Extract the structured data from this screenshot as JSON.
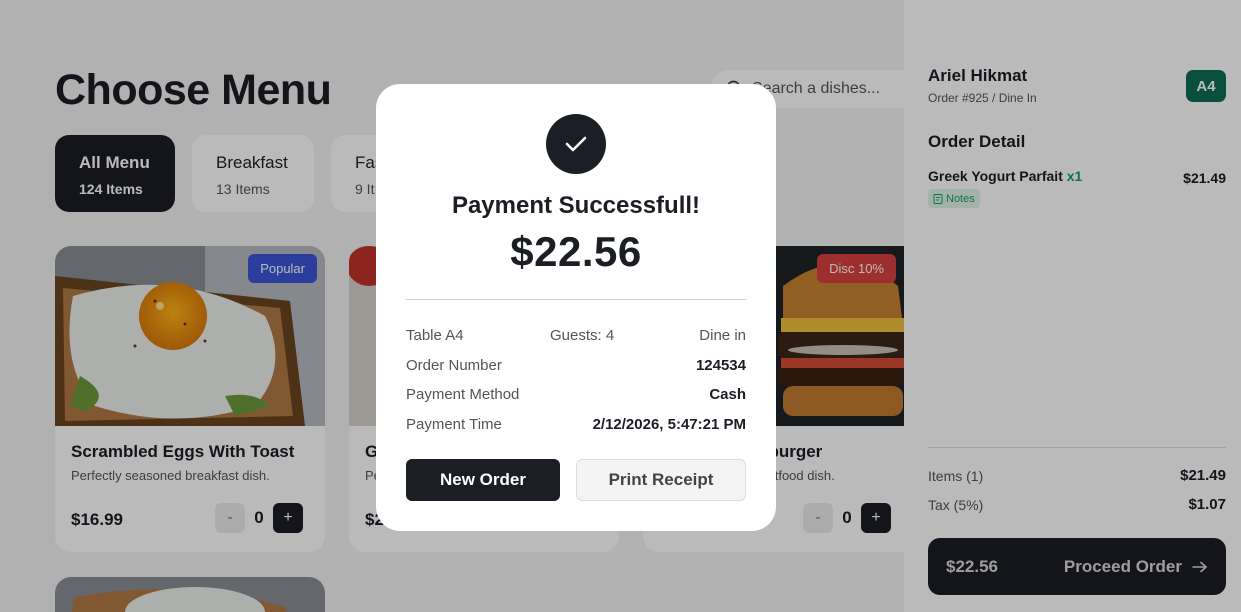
{
  "menu": {
    "title": "Choose Menu",
    "search_placeholder": "Search a dishes...",
    "categories": [
      {
        "name": "All Menu",
        "count": "124 Items",
        "active": true
      },
      {
        "name": "Breakfast",
        "count": "13 Items"
      },
      {
        "name": "Fas",
        "count": "9 It"
      }
    ],
    "cards": [
      {
        "name": "Scrambled Eggs With Toast",
        "description": "Perfectly seasoned breakfast dish.",
        "price": "$16.99",
        "badge": "Popular",
        "quantity": "0"
      },
      {
        "name": "G",
        "description": "Pe",
        "price": "$2"
      },
      {
        "name": "eburger",
        "description": "astfood dish.",
        "badge": "Disc 10%",
        "quantity": "0"
      }
    ],
    "stepper": {
      "minus": "-",
      "plus": "+"
    }
  },
  "order": {
    "customer": "Ariel Hikmat",
    "meta": "Order #925 / Dine In",
    "table_badge": "A4",
    "detail_heading": "Order Detail",
    "item": {
      "name": "Greek Yogurt Parfait",
      "qty": "x1",
      "price": "$21.49",
      "notes_label": "Notes"
    },
    "summary": {
      "items_label": "Items (1)",
      "items_value": "$21.49",
      "tax_label": "Tax (5%)",
      "tax_value": "$1.07"
    },
    "proceed": {
      "total": "$22.56",
      "label": "Proceed Order"
    }
  },
  "modal": {
    "title": "Payment Successfull!",
    "amount": "$22.56",
    "table": "Table A4",
    "guests": "Guests: 4",
    "service": "Dine in",
    "order_number_label": "Order Number",
    "order_number": "124534",
    "payment_method_label": "Payment Method",
    "payment_method": "Cash",
    "payment_time_label": "Payment Time",
    "payment_time": "2/12/2026, 5:47:21 PM",
    "new_order": "New Order",
    "print_receipt": "Print Receipt"
  },
  "colors": {
    "dark": "#1c1e26",
    "table_badge": "#0f6b54",
    "badge_popular": "#3b55d9",
    "badge_discount": "#d94141",
    "notes_green": "#12a06e"
  },
  "icons": {
    "search": "search-icon",
    "check": "check-icon",
    "arrow": "arrow-right-icon",
    "notes": "notes-icon"
  }
}
